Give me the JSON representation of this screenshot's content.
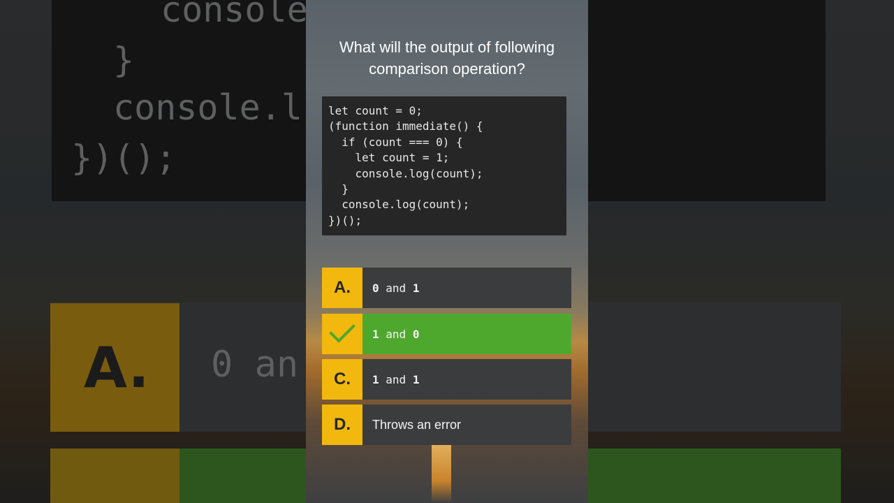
{
  "question": {
    "line1": "What will the output of following",
    "line2": "comparison operation?"
  },
  "code_lines": [
    "let count = 0;",
    "(function immediate() {",
    "  if (count === 0) {",
    "    let count = 1;",
    "    console.log(count);",
    "  }",
    "  console.log(count);",
    "})();"
  ],
  "options": [
    {
      "letter": "A.",
      "text_a": "0",
      "and": "and",
      "text_b": "1",
      "correct": false
    },
    {
      "letter": "",
      "icon": "check-icon",
      "text_a": "1",
      "and": "and",
      "text_b": "0",
      "correct": true
    },
    {
      "letter": "C.",
      "text_a": "1",
      "and": "and",
      "text_b": "1",
      "correct": false
    },
    {
      "letter": "D.",
      "text": "Throws an error",
      "correct": false
    }
  ],
  "colors": {
    "letter_bg": "#f2b80d",
    "option_bg": "#3b3c3d",
    "correct_bg": "#4fa82e",
    "check": "#4fa82e"
  }
}
